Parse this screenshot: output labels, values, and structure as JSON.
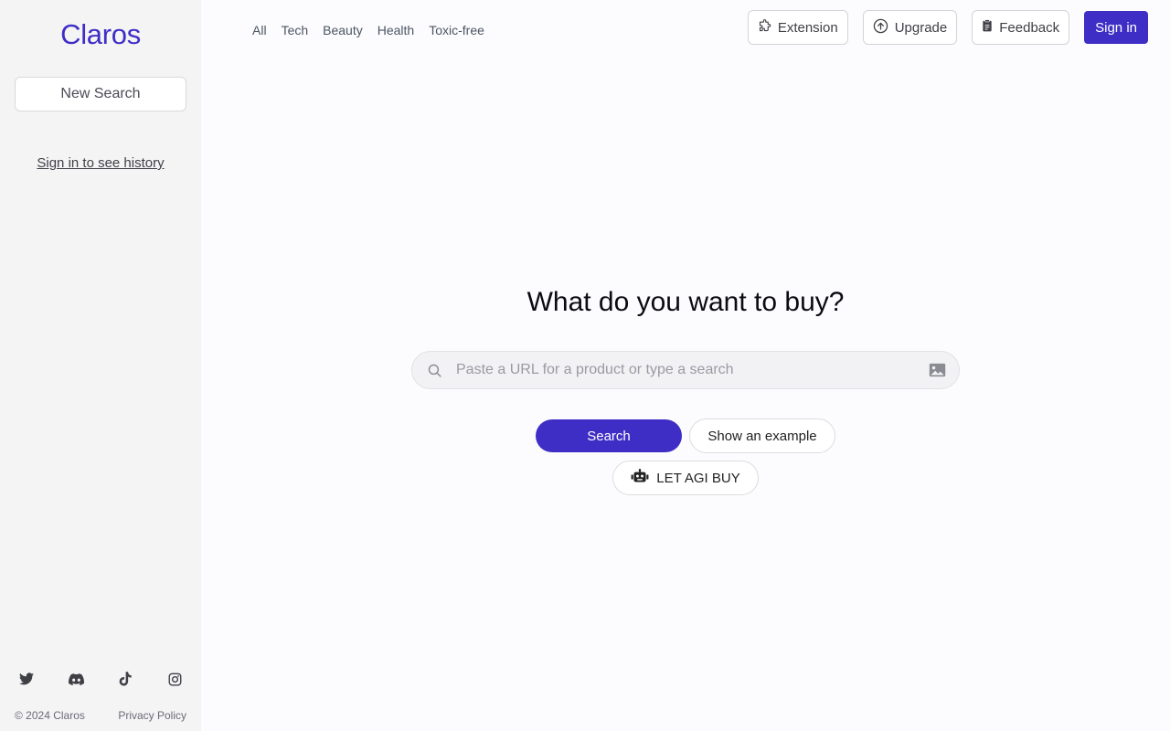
{
  "sidebar": {
    "brand": "Claros",
    "new_search_label": "New Search",
    "history_link": "Sign in to see history",
    "socials": [
      "twitter-icon",
      "discord-icon",
      "tiktok-icon",
      "instagram-icon"
    ],
    "copyright": "© 2024 Claros",
    "privacy_label": "Privacy Policy"
  },
  "nav": {
    "categories": [
      "All",
      "Tech",
      "Beauty",
      "Health",
      "Toxic-free"
    ]
  },
  "header": {
    "extension_label": "Extension",
    "upgrade_label": "Upgrade",
    "feedback_label": "Feedback",
    "signin_label": "Sign in"
  },
  "main": {
    "headline": "What do you want to buy?",
    "search_placeholder": "Paste a URL for a product or type a search",
    "search_value": "",
    "search_button": "Search",
    "example_button": "Show an example",
    "agi_button": "LET AGI BUY"
  },
  "colors": {
    "accent": "#3f2ec6",
    "sidebar_bg": "#f4f4f5",
    "page_bg": "#fcfcfe"
  }
}
